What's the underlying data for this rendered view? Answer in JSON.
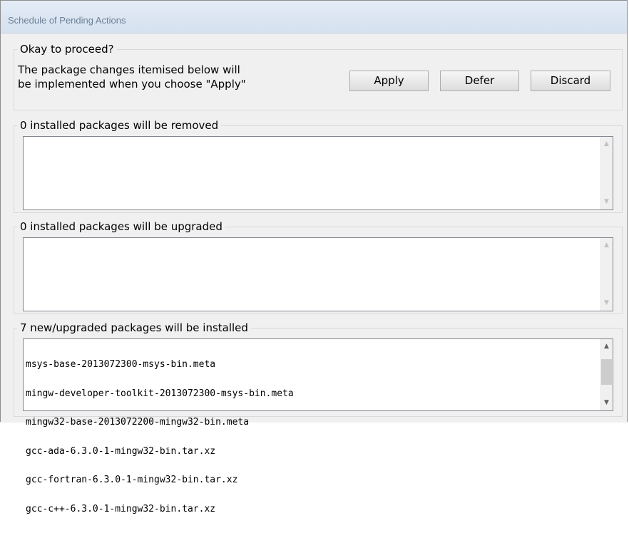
{
  "window": {
    "title": "Schedule of Pending Actions"
  },
  "proceed": {
    "caption": "Okay to proceed?",
    "message_line1": "The package changes itemised below will",
    "message_line2": "be implemented when you choose \"Apply\"",
    "apply_label": "Apply",
    "defer_label": "Defer",
    "discard_label": "Discard"
  },
  "removed": {
    "caption": "0 installed packages will be removed",
    "items": []
  },
  "upgraded": {
    "caption": "0 installed packages will be upgraded",
    "items": []
  },
  "installed": {
    "caption": "7 new/upgraded packages will be installed",
    "items": [
      "msys-base-2013072300-msys-bin.meta",
      "mingw-developer-toolkit-2013072300-msys-bin.meta",
      "mingw32-base-2013072200-mingw32-bin.meta",
      "gcc-ada-6.3.0-1-mingw32-bin.tar.xz",
      "gcc-fortran-6.3.0-1-mingw32-bin.tar.xz",
      "gcc-c++-6.3.0-1-mingw32-bin.tar.xz"
    ]
  },
  "icons": {
    "scroll_up": "▲",
    "scroll_down": "▼"
  }
}
